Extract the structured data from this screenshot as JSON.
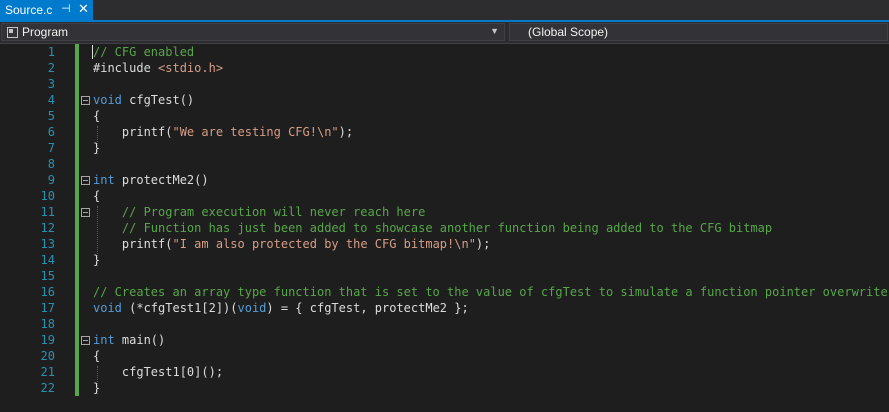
{
  "tab": {
    "title": "Source.c",
    "pin_glyph": "⊣",
    "close_glyph": "✕"
  },
  "nav": {
    "project": "Program",
    "scope": "(Global Scope)"
  },
  "lines": [
    {
      "n": "1",
      "tokens": [
        {
          "t": "// CFG enabled",
          "c": "cm"
        }
      ]
    },
    {
      "n": "2",
      "tokens": [
        {
          "t": "#include ",
          "c": "pp"
        },
        {
          "t": "<stdio.h>",
          "c": "inc"
        }
      ]
    },
    {
      "n": "3",
      "tokens": []
    },
    {
      "n": "4",
      "fold": true,
      "tokens": [
        {
          "t": "void",
          "c": "kw"
        },
        {
          "t": " cfgTest()",
          "c": "tx"
        }
      ]
    },
    {
      "n": "5",
      "tokens": [
        {
          "t": "{",
          "c": "tx"
        }
      ]
    },
    {
      "n": "6",
      "tokens": [
        {
          "t": "    printf(",
          "c": "tx"
        },
        {
          "t": "\"We are testing CFG!\\n\"",
          "c": "st"
        },
        {
          "t": ");",
          "c": "tx"
        }
      ]
    },
    {
      "n": "7",
      "tokens": [
        {
          "t": "}",
          "c": "tx"
        }
      ]
    },
    {
      "n": "8",
      "tokens": []
    },
    {
      "n": "9",
      "fold": true,
      "tokens": [
        {
          "t": "int",
          "c": "kw"
        },
        {
          "t": " protectMe2()",
          "c": "tx"
        }
      ]
    },
    {
      "n": "10",
      "tokens": [
        {
          "t": "{",
          "c": "tx"
        }
      ]
    },
    {
      "n": "11",
      "fold": true,
      "tokens": [
        {
          "t": "    // Program execution will never reach here",
          "c": "cm"
        }
      ]
    },
    {
      "n": "12",
      "tokens": [
        {
          "t": "    // Function has just been added to showcase another function being added to the CFG bitmap",
          "c": "cm"
        }
      ]
    },
    {
      "n": "13",
      "tokens": [
        {
          "t": "    printf(",
          "c": "tx"
        },
        {
          "t": "\"I am also protected by the CFG bitmap!\\n\"",
          "c": "st"
        },
        {
          "t": ");",
          "c": "tx"
        }
      ]
    },
    {
      "n": "14",
      "tokens": [
        {
          "t": "}",
          "c": "tx"
        }
      ]
    },
    {
      "n": "15",
      "tokens": []
    },
    {
      "n": "16",
      "tokens": [
        {
          "t": "// Creates an array type function that is set to the value of cfgTest to simulate a function pointer overwrite",
          "c": "cm"
        }
      ]
    },
    {
      "n": "17",
      "tokens": [
        {
          "t": "void",
          "c": "kw"
        },
        {
          "t": " (*cfgTest1[2])(",
          "c": "tx"
        },
        {
          "t": "void",
          "c": "kw"
        },
        {
          "t": ") = { cfgTest, protectMe2 };",
          "c": "tx"
        }
      ]
    },
    {
      "n": "18",
      "tokens": []
    },
    {
      "n": "19",
      "fold": true,
      "tokens": [
        {
          "t": "int",
          "c": "kw"
        },
        {
          "t": " main()",
          "c": "tx"
        }
      ]
    },
    {
      "n": "20",
      "tokens": [
        {
          "t": "{",
          "c": "tx"
        }
      ]
    },
    {
      "n": "21",
      "tokens": [
        {
          "t": "    cfgTest1[0]();",
          "c": "tx"
        }
      ]
    },
    {
      "n": "22",
      "tokens": [
        {
          "t": "}",
          "c": "tx"
        }
      ]
    }
  ],
  "colors": {
    "background": "#1e1e1e",
    "accent": "#007acc",
    "keyword": "#569cd6",
    "comment": "#57a64a",
    "string": "#d69d85",
    "line_number": "#2b91af"
  }
}
